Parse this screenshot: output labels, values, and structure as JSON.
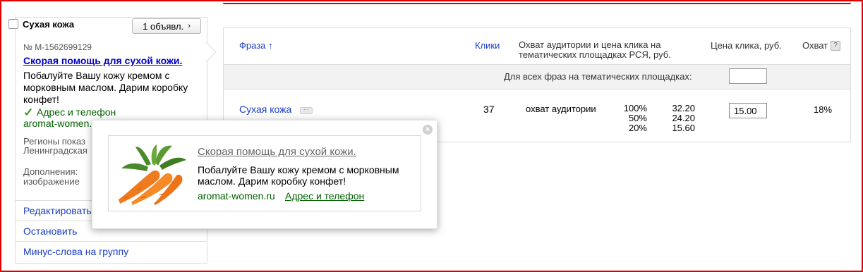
{
  "group": {
    "title": "Сухая кожа",
    "count_button": "1 объявл.",
    "ad_number": "№ М-1562699129",
    "ad_title": "Скорая помощь для сухой кожи.",
    "ad_text": "Побалуйте Вашу кожу кремом с морковным маслом. Дарим коробку конфет!",
    "contacts_link": "Адрес и телефон",
    "domain": "aromat-women.",
    "regions_label": "Регионы показ",
    "regions_value": "Ленинградская",
    "addons_label": "Дополнения:",
    "addons_value": "изображение",
    "actions": [
      "Редактировать",
      "Остановить",
      "Минус-слова на группу"
    ]
  },
  "table": {
    "headers": {
      "phrase": "Фраза",
      "sort_arrow": "↑",
      "clicks": "Клики",
      "reach": "Охват аудитории и цена клика на тематических площадках РСЯ, руб.",
      "cpc": "Цена клика, руб.",
      "coverage": "Охват",
      "help": "?"
    },
    "all_phrases_label": "Для всех фраз на тематических площадках:",
    "all_phrases_value": "",
    "rows": [
      {
        "phrase": "Сухая кожа",
        "dots": "···",
        "clicks": "37",
        "reach_label": "охват аудитории",
        "pct": [
          "100%",
          "50%",
          "20%"
        ],
        "prices": [
          "32.20",
          "24.20",
          "15.60"
        ],
        "cpc": "15.00",
        "coverage": "18%"
      }
    ]
  },
  "popup": {
    "close": "×",
    "title": "Скорая помощь для сухой кожи.",
    "text": "Побалуйте Вашу кожу кремом с морковным маслом. Дарим коробку конфет!",
    "domain": "aromat-women.ru",
    "contacts": "Адрес и телефон",
    "image": "carrots"
  },
  "colors": {
    "link": "#1a3dc1",
    "green": "#006000",
    "frame": "#e00000"
  }
}
